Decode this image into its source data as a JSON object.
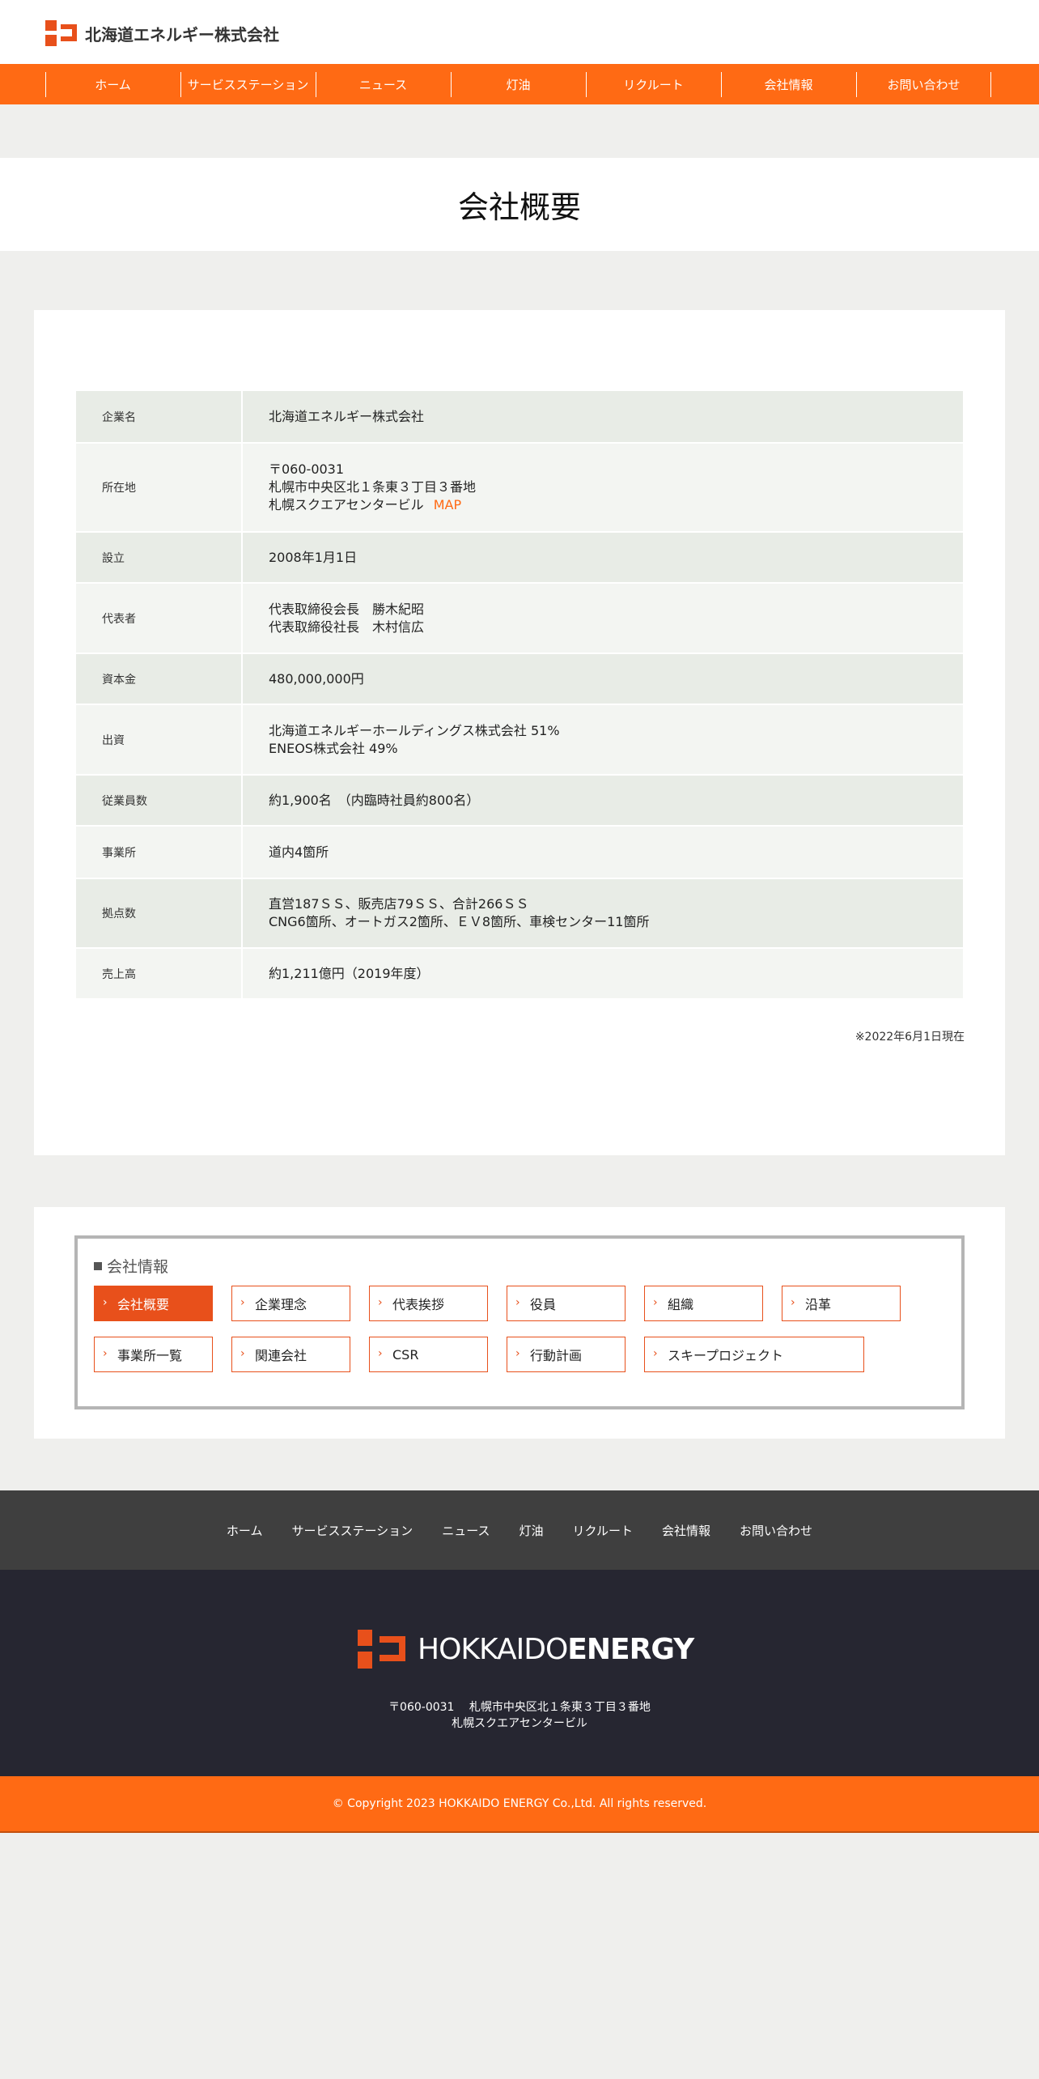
{
  "header": {
    "logo_text": "北海道エネルギー株式会社"
  },
  "nav": {
    "items": [
      "ホーム",
      "サービスステーション",
      "ニュース",
      "灯油",
      "リクルート",
      "会社情報",
      "お問い合わせ"
    ]
  },
  "page": {
    "title": "会社概要"
  },
  "company_table": {
    "rows": [
      {
        "label": "企業名",
        "lines": [
          "北海道エネルギー株式会社"
        ]
      },
      {
        "label": "所在地",
        "lines": [
          "〒060-0031",
          "札幌市中央区北１条東３丁目３番地",
          "札幌スクエアセンタービル"
        ],
        "link": "MAP"
      },
      {
        "label": "設立",
        "lines": [
          "2008年1月1日"
        ]
      },
      {
        "label": "代表者",
        "lines": [
          "代表取締役会長　勝木紀昭",
          "代表取締役社長　木村信広"
        ]
      },
      {
        "label": "資本金",
        "lines": [
          "480,000,000円"
        ]
      },
      {
        "label": "出資",
        "lines": [
          "北海道エネルギーホールディングス株式会社 51%",
          "ENEOS株式会社 49%"
        ]
      },
      {
        "label": "従業員数",
        "lines": [
          "約1,900名　（内臨時社員約800名）"
        ]
      },
      {
        "label": "事業所",
        "lines": [
          "道内4箇所"
        ]
      },
      {
        "label": "拠点数",
        "lines": [
          "直営187ＳＳ、販売店79ＳＳ、合計266ＳＳ",
          "CNG6箇所、オートガス2箇所、ＥＶ8箇所、車検センター11箇所"
        ]
      },
      {
        "label": "売上高",
        "lines": [
          "約1,211億円（2019年度）"
        ]
      }
    ],
    "as_of": "※2022年6月1日現在"
  },
  "company_menu": {
    "heading": "会社情報",
    "items": [
      "会社概要",
      "企業理念",
      "代表挨拶",
      "役員",
      "組織",
      "沿革",
      "事業所一覧",
      "関連会社",
      "CSR",
      "行動計画",
      "スキープロジェクト"
    ],
    "active": "会社概要"
  },
  "footer_nav": {
    "items": [
      "ホーム",
      "サービスステーション",
      "ニュース",
      "灯油",
      "リクルート",
      "会社情報",
      "お問い合わせ"
    ]
  },
  "footer": {
    "logo_light": "HOKKAIDO",
    "logo_bold": "ENERGY",
    "address_line1": "〒060-0031　 札幌市中央区北１条東３丁目３番地",
    "address_line2": "札幌スクエアセンタービル",
    "copyright": "© Copyright 2023 HOKKAIDO ENERGY Co.,Ltd. All rights reserved."
  },
  "colors": {
    "accent": "#ff6a14",
    "brand": "#e8501b",
    "footer_dark": "#262631",
    "footer_nav": "#3f3f3f"
  }
}
